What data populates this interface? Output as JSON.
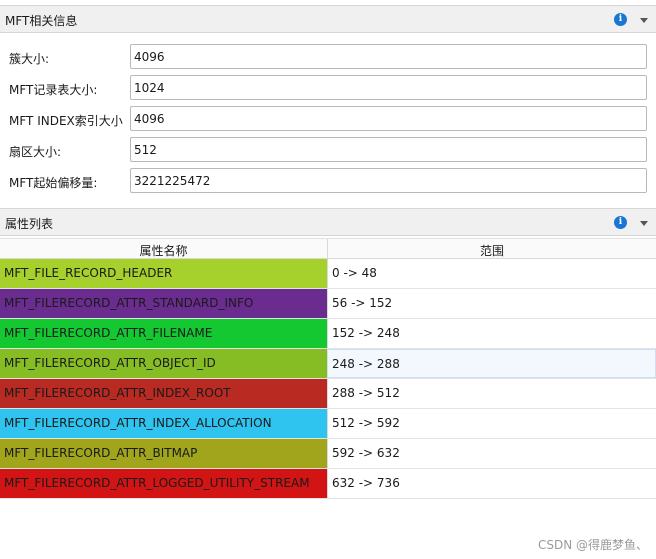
{
  "mft_section": {
    "title": "MFT相关信息",
    "fields": [
      {
        "label": "簇大小:",
        "value": "4096"
      },
      {
        "label": "MFT记录表大小:",
        "value": "1024"
      },
      {
        "label": "MFT INDEX索引大小",
        "value": "4096"
      },
      {
        "label": "扇区大小:",
        "value": "512"
      },
      {
        "label": "MFT起始偏移量:",
        "value": "3221225472"
      }
    ]
  },
  "attr_section": {
    "title": "属性列表",
    "columns": {
      "name": "属性名称",
      "range": "范围"
    },
    "rows": [
      {
        "name": "MFT_FILE_RECORD_HEADER",
        "range": "0 -> 48",
        "color": "#a6d12d"
      },
      {
        "name": "MFT_FILERECORD_ATTR_STANDARD_INFO",
        "range": "56 -> 152",
        "color": "#6b2c8f"
      },
      {
        "name": "MFT_FILERECORD_ATTR_FILENAME",
        "range": "152 -> 248",
        "color": "#14c832"
      },
      {
        "name": "MFT_FILERECORD_ATTR_OBJECT_ID",
        "range": "248 -> 288",
        "color": "#86bd24"
      },
      {
        "name": "MFT_FILERECORD_ATTR_INDEX_ROOT",
        "range": "288 -> 512",
        "color": "#b82a22"
      },
      {
        "name": "MFT_FILERECORD_ATTR_INDEX_ALLOCATION",
        "range": "512 -> 592",
        "color": "#2fc3ef"
      },
      {
        "name": "MFT_FILERECORD_ATTR_BITMAP",
        "range": "592 -> 632",
        "color": "#a0a51c"
      },
      {
        "name": "MFT_FILERECORD_ATTR_LOGGED_UTILITY_STREAM",
        "range": "632 -> 736",
        "color": "#d21414"
      }
    ]
  },
  "icons": {
    "info": "info-icon",
    "collapse": "chevron-down-icon",
    "info_glyph": "i"
  },
  "watermark": "CSDN @得鹿梦鱼、"
}
